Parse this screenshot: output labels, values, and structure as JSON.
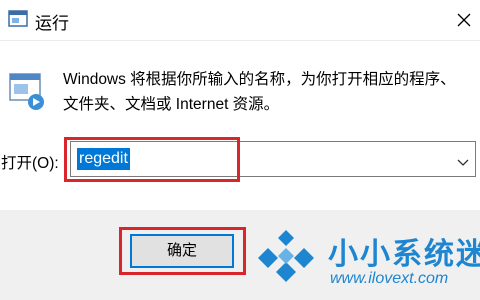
{
  "window": {
    "title": "运行"
  },
  "description": {
    "line1": "Windows 将根据你所输入的名称，为你打开相应的程序、",
    "line2": "文件夹、文档或 Internet 资源。"
  },
  "open_field": {
    "label": "打开(O):",
    "value": "regedit"
  },
  "buttons": {
    "ok_label": "确定"
  },
  "watermark": {
    "text": "小小系统迷",
    "url": "www.ilovext.com"
  },
  "colors": {
    "highlight": "#d9262c",
    "selection": "#0078d7",
    "watermark": "#1e86d0"
  }
}
